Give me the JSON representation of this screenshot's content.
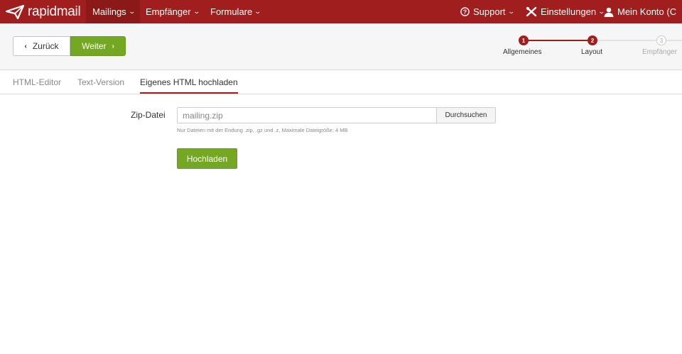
{
  "brand": {
    "name": "rapidmail",
    "icon": "paper-plane-icon"
  },
  "nav": {
    "items": [
      {
        "label": "Mailings",
        "icon": "chevron-down-icon"
      },
      {
        "label": "Empfänger",
        "icon": "chevron-down-icon"
      },
      {
        "label": "Formulare",
        "icon": "chevron-down-icon"
      }
    ],
    "support": "Support",
    "settings": "Einstellungen",
    "account": "Mein Konto (C"
  },
  "toolbar": {
    "back_label": "Zurück",
    "next_label": "Weiter"
  },
  "steps": [
    {
      "number": "1",
      "label": "Allgemeines",
      "state": "done"
    },
    {
      "number": "2",
      "label": "Layout",
      "state": "current"
    },
    {
      "number": "3",
      "label": "Empfänger",
      "state": "todo"
    }
  ],
  "tabs": [
    {
      "label": "HTML-Editor",
      "active": false
    },
    {
      "label": "Text-Version",
      "active": false
    },
    {
      "label": "Eigenes HTML hochladen",
      "active": true
    }
  ],
  "form": {
    "label": "Zip-Datei",
    "value": "mailing.zip",
    "browse_label": "Durchsuchen",
    "help": "Nur Dateien mit der Endung .zip, .gz und .z, Maximale Dateigröße: 4 MB",
    "upload_label": "Hochladen"
  },
  "colors": {
    "brand": "#a01f1e",
    "accent_green": "#74a823"
  }
}
